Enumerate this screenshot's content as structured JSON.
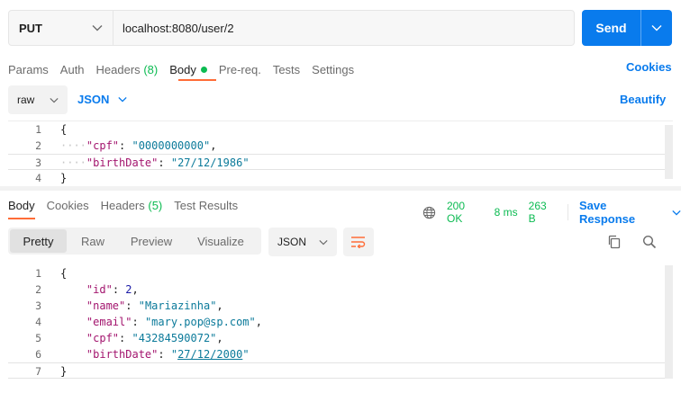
{
  "request": {
    "method": "PUT",
    "url": "localhost:8080/user/2",
    "send_label": "Send"
  },
  "request_tabs": [
    {
      "label": "Params"
    },
    {
      "label": "Auth"
    },
    {
      "label": "Headers",
      "count": "(8)"
    },
    {
      "label": "Body"
    },
    {
      "label": "Pre-req."
    },
    {
      "label": "Tests"
    },
    {
      "label": "Settings"
    }
  ],
  "cookies_label": "Cookies",
  "body_options": {
    "mode": "raw",
    "language": "JSON",
    "beautify_label": "Beautify"
  },
  "request_body": {
    "line_numbers": [
      "1",
      "2",
      "3",
      "4"
    ],
    "lines": [
      {
        "text": "{"
      },
      {
        "key": "\"cpf\"",
        "sep": ": ",
        "value": "\"0000000000\"",
        "end": ","
      },
      {
        "key": "\"birthDate\"",
        "sep": ": ",
        "value": "\"27/12/1986\"",
        "end": ""
      },
      {
        "text": "}"
      }
    ]
  },
  "response_tabs": [
    {
      "label": "Body"
    },
    {
      "label": "Cookies"
    },
    {
      "label": "Headers",
      "count": "(5)"
    },
    {
      "label": "Test Results"
    }
  ],
  "response_status": {
    "status": "200 OK",
    "time": "8 ms",
    "size": "263 B",
    "save_label": "Save Response"
  },
  "response_view": {
    "modes": [
      "Pretty",
      "Raw",
      "Preview",
      "Visualize"
    ],
    "active_mode": "Pretty",
    "format": "JSON"
  },
  "response_body": {
    "line_numbers": [
      "1",
      "2",
      "3",
      "4",
      "5",
      "6",
      "7"
    ],
    "lines": [
      {
        "text": "{"
      },
      {
        "key": "\"id\"",
        "sep": ": ",
        "value": "2",
        "end": ","
      },
      {
        "key": "\"name\"",
        "sep": ": ",
        "value": "\"Mariazinha\"",
        "end": ","
      },
      {
        "key": "\"email\"",
        "sep": ": ",
        "value": "\"mary.pop@sp.com\"",
        "end": ","
      },
      {
        "key": "\"cpf\"",
        "sep": ": ",
        "value": "\"43284590072\"",
        "end": ","
      },
      {
        "key": "\"birthDate\"",
        "sep": ": ",
        "value_pre": "\"",
        "value_link": "27/12/2000",
        "value_post": "\"",
        "end": ""
      },
      {
        "text": "}"
      }
    ]
  },
  "colors": {
    "accent": "#097bed",
    "tab_indicator": "#ff6c37",
    "success": "#0cbb52",
    "json_key": "#a3156e",
    "json_string": "#0b7a9a"
  }
}
